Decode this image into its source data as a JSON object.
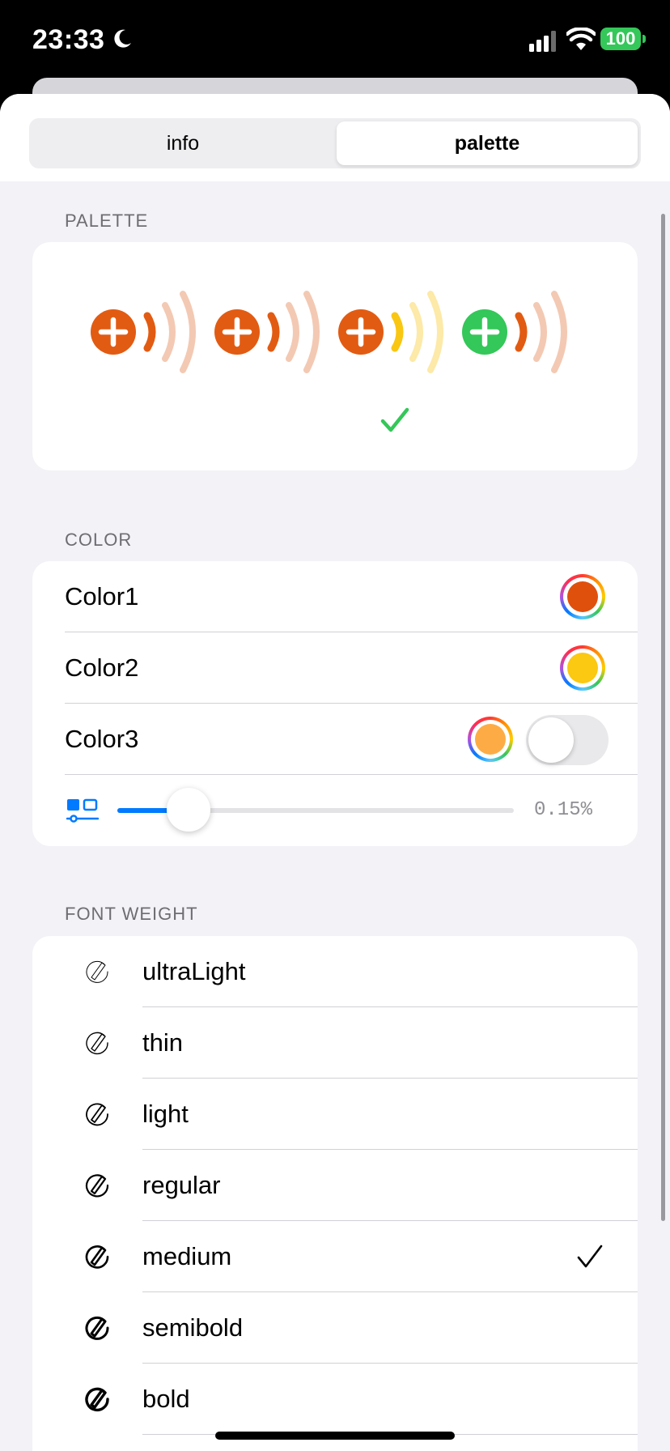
{
  "status_bar": {
    "time": "23:33",
    "battery": "100"
  },
  "segmented": {
    "tabs": [
      {
        "label": "info"
      },
      {
        "label": "palette",
        "selected": true
      }
    ]
  },
  "palette_section": {
    "header": "PALETTE",
    "icon": "speaker-wave-plus-icon",
    "variants": [
      {
        "plus": "#e25b12",
        "wave1": "#e25b12",
        "wave2": "#f3c9b3",
        "wave3": "#f3c9b3"
      },
      {
        "plus": "#e25b12",
        "wave1": "#e25b12",
        "wave2": "#f3c9b3",
        "wave3": "#f3c9b3"
      },
      {
        "plus": "#e25b12",
        "wave1": "#f9c612",
        "wave2": "#fde9a8",
        "wave3": "#fde9a8",
        "selected": true
      },
      {
        "plus": "#34c759",
        "wave1": "#e25b12",
        "wave2": "#f3c9b3",
        "wave3": "#f3c9b3"
      }
    ],
    "check_color": "#34c759"
  },
  "color_section": {
    "header": "COLOR",
    "rows": [
      {
        "label": "Color1",
        "color": "#e0500d"
      },
      {
        "label": "Color2",
        "color": "#fbc812"
      },
      {
        "label": "Color3",
        "color": "#fdac45",
        "toggle_on": false
      }
    ],
    "slider": {
      "value_label": "0.15%",
      "fraction": 0.18,
      "icon": "layers-slider-icon"
    }
  },
  "font_weight_section": {
    "header": "FONT WEIGHT",
    "items": [
      {
        "label": "ultraLight",
        "stroke": 1.0
      },
      {
        "label": "thin",
        "stroke": 1.4
      },
      {
        "label": "light",
        "stroke": 1.8
      },
      {
        "label": "regular",
        "stroke": 2.2
      },
      {
        "label": "medium",
        "stroke": 2.6,
        "selected": true
      },
      {
        "label": "semibold",
        "stroke": 3.0
      },
      {
        "label": "bold",
        "stroke": 3.4
      }
    ]
  }
}
